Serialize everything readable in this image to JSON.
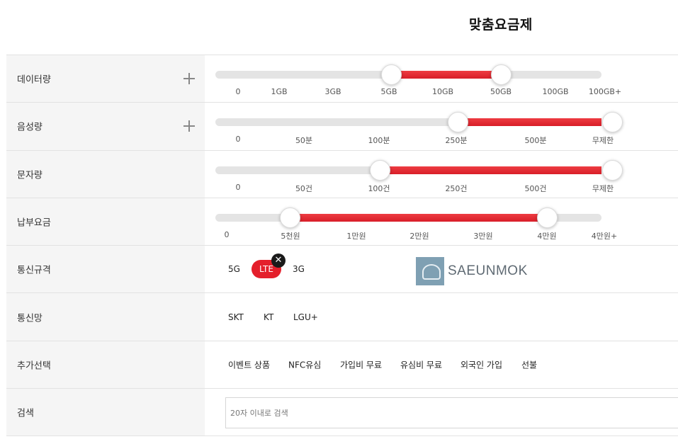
{
  "page_title": "맞춤요금제",
  "filters": {
    "data": {
      "label": "데이터량",
      "ticks": [
        "0",
        "1GB",
        "3GB",
        "5GB",
        "10GB",
        "50GB",
        "100GB",
        "100GB+"
      ],
      "selected_range": [
        "5GB",
        "50GB"
      ]
    },
    "voice": {
      "label": "음성량",
      "ticks": [
        "0",
        "50분",
        "100분",
        "250분",
        "500분",
        "무제한"
      ],
      "selected_range": [
        "250분",
        "무제한"
      ]
    },
    "sms": {
      "label": "문자량",
      "ticks": [
        "0",
        "50건",
        "100건",
        "250건",
        "500건",
        "무제한"
      ],
      "selected_range": [
        "100건",
        "무제한"
      ]
    },
    "fee": {
      "label": "납부요금",
      "ticks": [
        "0",
        "5천원",
        "1만원",
        "2만원",
        "3만원",
        "4만원",
        "4만원+"
      ],
      "selected_range": [
        "5천원",
        "4만원"
      ]
    },
    "standard": {
      "label": "통신규격",
      "options": [
        "5G",
        "LTE",
        "3G"
      ],
      "selected": "LTE",
      "remove_glyph": "✕"
    },
    "network": {
      "label": "통신망",
      "options": [
        "SKT",
        "KT",
        "LGU+"
      ]
    },
    "extras": {
      "label": "추가선택",
      "options": [
        "이벤트 상품",
        "NFC유심",
        "가입비 무료",
        "유심비 무료",
        "외국인 가입",
        "선불"
      ]
    },
    "search": {
      "label": "검색",
      "placeholder": "20자 이내로 검색",
      "value": ""
    }
  },
  "watermark": {
    "text": "SAEUNMOK"
  },
  "colors": {
    "accent": "#e41f2b",
    "track": "#e4e4e4",
    "label_bg": "#f5f5f5"
  }
}
